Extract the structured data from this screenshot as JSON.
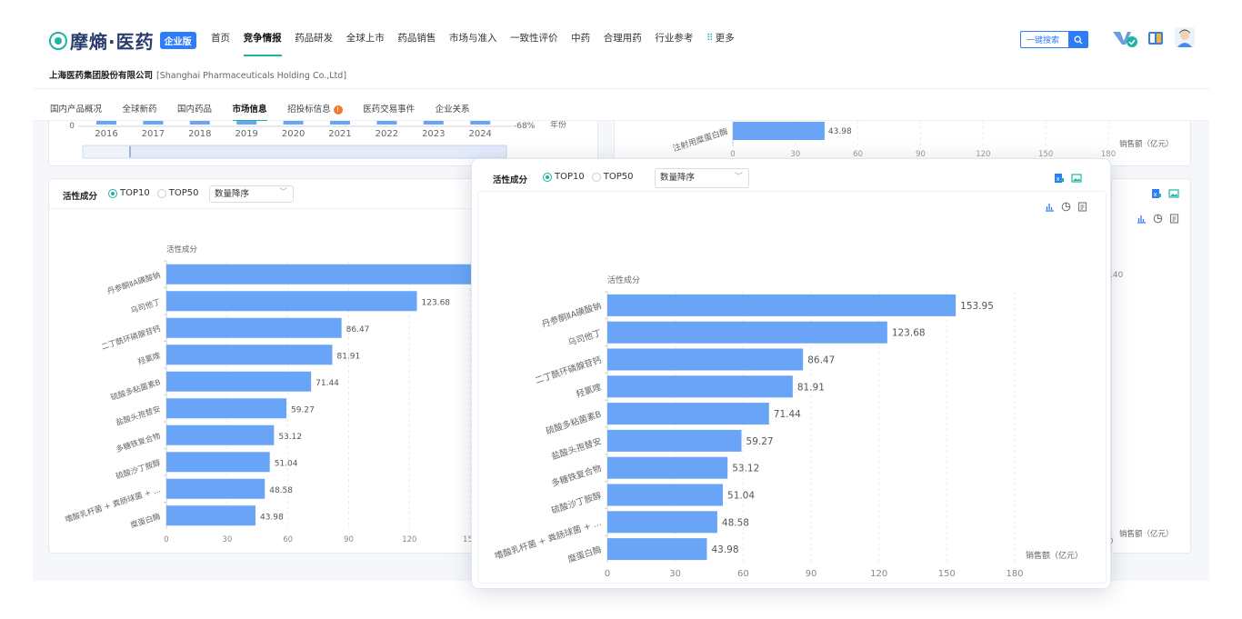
{
  "brand": {
    "name": "摩熵·医药",
    "edition": "企业版"
  },
  "menu": {
    "items": [
      "首页",
      "竞争情报",
      "药品研发",
      "全球上市",
      "药品销售",
      "市场与准入",
      "一致性评价",
      "中药",
      "合理用药",
      "行业参考"
    ],
    "active_index": 1,
    "more": "更多"
  },
  "search": {
    "label": "一键搜索"
  },
  "company": {
    "name_cn": "上海医药集团股份有限公司",
    "name_en": "[Shanghai Pharmaceuticals Holding Co.,Ltd]"
  },
  "tabs": {
    "items": [
      "国内产品概况",
      "全球新药",
      "国内药品",
      "市场信息",
      "招投标信息",
      "医药交易事件",
      "企业关系"
    ],
    "active_index": 3,
    "badge_index": 4,
    "badge_text": "!"
  },
  "top_chart": {
    "years": [
      "2016",
      "2017",
      "2018",
      "2019",
      "2020",
      "2021",
      "2022",
      "2023",
      "2024"
    ],
    "y0": "0",
    "pct": "-68%",
    "right_label": "年份"
  },
  "top_right_chart": {
    "category": "注射用糜蛋白酶",
    "value": "43.98",
    "ticks": [
      "0",
      "30",
      "60",
      "90",
      "120",
      "150",
      "180"
    ],
    "unit": "销售额（亿元）"
  },
  "panel": {
    "title": "活性成分",
    "radio_top10": "TOP10",
    "radio_top50": "TOP50",
    "sort": "数量降序"
  },
  "right_stub": {
    "value_fragment": ".40",
    "unit": "销售额（亿元）",
    "tick": "0"
  },
  "colors": {
    "bar": "#6aa4f7",
    "accent": "#1fb3a4",
    "brand_blue": "#2e7cf6"
  },
  "chart_data": {
    "type": "bar",
    "orientation": "horizontal",
    "ylabel": "活性成分",
    "xlabel": "销售额（亿元）",
    "categories": [
      "丹参酮ⅡA磺酸钠",
      "乌司他丁",
      "二丁酰环磷腺苷钙",
      "羟氯喹",
      "硫酸多粘菌素B",
      "盐酸头孢替安",
      "多糖铁复合物",
      "硫酸沙丁胺醇",
      "嗜酸乳杆菌 + 粪肠球菌 + ...",
      "糜蛋白酶"
    ],
    "values": [
      153.95,
      123.68,
      86.47,
      81.91,
      71.44,
      59.27,
      53.12,
      51.04,
      48.58,
      43.98
    ],
    "value_labels": [
      "153.95",
      "123.68",
      "86.47",
      "81.91",
      "71.44",
      "59.27",
      "53.12",
      "51.04",
      "48.58",
      "43.98"
    ],
    "xticks": [
      "0",
      "30",
      "60",
      "90",
      "120",
      "150",
      "180"
    ],
    "xlim": [
      0,
      180
    ],
    "grid": true
  }
}
